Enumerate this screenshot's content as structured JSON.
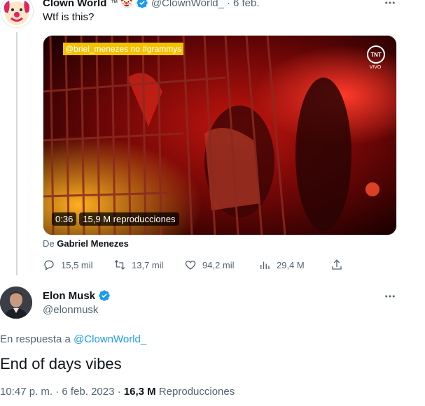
{
  "quoted_tweet": {
    "display_name": "Clown World",
    "tm": "™",
    "emoji": "🤡",
    "handle": "@ClownWorld_",
    "separator": "·",
    "date": "6 feb.",
    "text": "Wtf is this?",
    "video": {
      "caption": "@briel_menezes no #grammys",
      "network_logo": "TNT",
      "network_sub": "VIVO",
      "time": "0:36",
      "views": "15,9 M reproducciones"
    },
    "attribution_prefix": "De",
    "attribution_name": "Gabriel Menezes",
    "stats": {
      "replies": "15,5 mil",
      "retweets": "13,7 mil",
      "likes": "94,2 mil",
      "views": "29,4 M"
    }
  },
  "reply_tweet": {
    "display_name": "Elon Musk",
    "handle": "@elonmusk",
    "reply_prefix": "En respuesta a",
    "reply_to": "@ClownWorld_",
    "text": "End of days vibes",
    "time": "10:47 p. m.",
    "separator": "·",
    "date": "6 feb. 2023",
    "separator2": "·",
    "views_count": "16,3 M",
    "views_label": "Reproducciones"
  },
  "colors": {
    "accent": "#1d9bf0",
    "muted": "#536471",
    "verified": "#1d9bf0"
  }
}
